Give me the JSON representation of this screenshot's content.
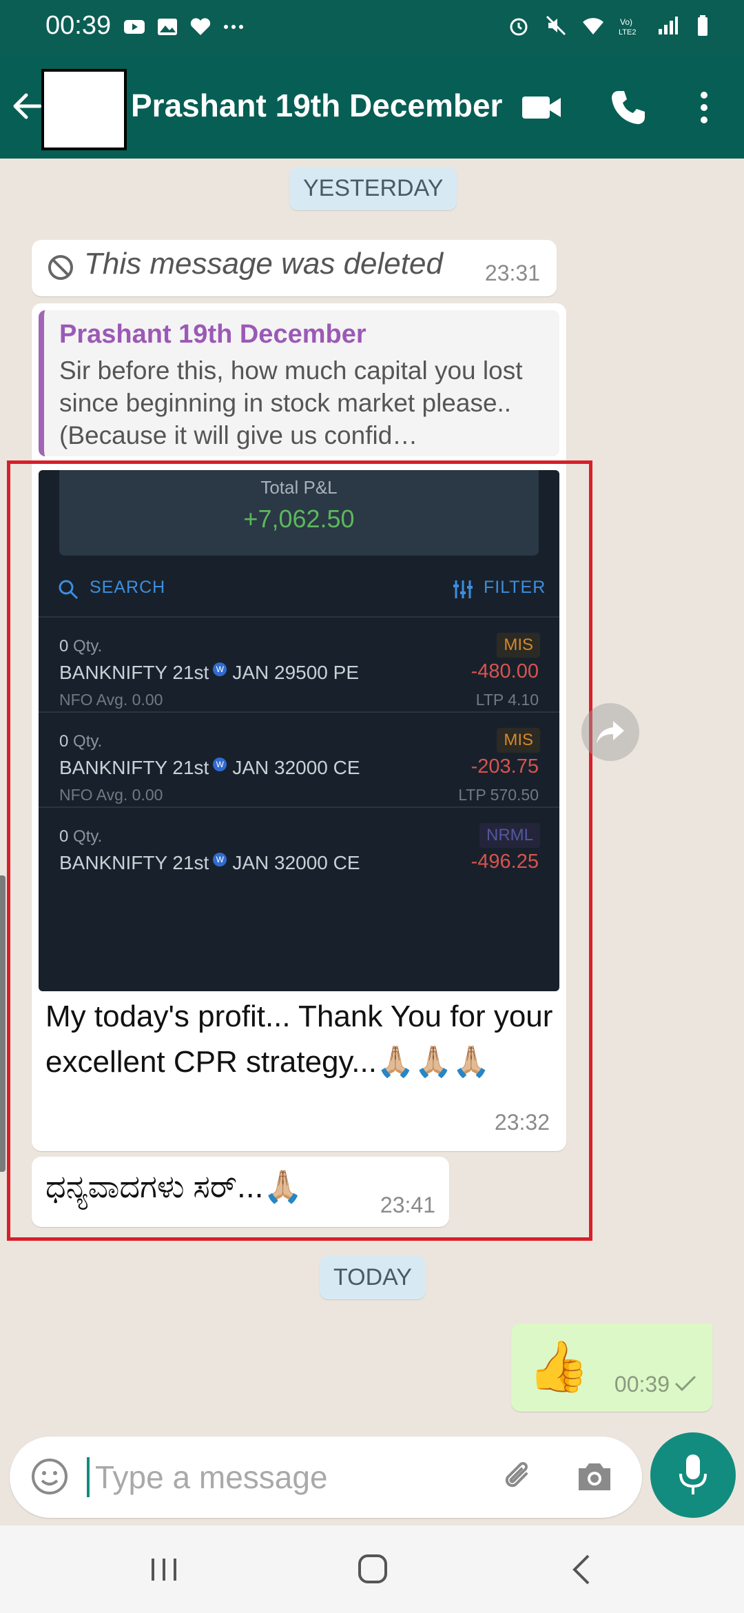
{
  "status_bar": {
    "time": "00:39"
  },
  "header": {
    "contact_name": "Prashant 19th December"
  },
  "chat": {
    "date_yesterday": "YESTERDAY",
    "date_today": "TODAY",
    "deleted_message": {
      "text": "This message was deleted",
      "time": "23:31"
    },
    "main_message": {
      "quote_author": "Prashant 19th December",
      "quote_text": "Sir before this, how much capital you lost since beginning in stock market please.. (Because it will give us confid…",
      "caption": "My today's profit... Thank You for your excellent CPR strategy...🙏🏼🙏🏼🙏🏼",
      "time": "23:32",
      "screenshot": {
        "total_pnl_label": "Total P&L",
        "total_pnl_value": "+7,062.50",
        "search_label": "SEARCH",
        "filter_label": "FILTER",
        "trades": [
          {
            "qty": "0",
            "qty_suffix": "Qty.",
            "name_prefix": "BANKNIFTY 21st",
            "name_suffix": "JAN 29500 PE",
            "meta": "NFO   Avg. 0.00",
            "badge": "MIS",
            "pnl": "-480.00",
            "ltp": "LTP 4.10"
          },
          {
            "qty": "0",
            "qty_suffix": "Qty.",
            "name_prefix": "BANKNIFTY 21st",
            "name_suffix": "JAN 32000 CE",
            "meta": "NFO   Avg. 0.00",
            "badge": "MIS",
            "pnl": "-203.75",
            "ltp": "LTP 570.50"
          },
          {
            "qty": "0",
            "qty_suffix": "Qty.",
            "name_prefix": "BANKNIFTY 21st",
            "name_suffix": "JAN 32000 CE",
            "badge": "NRML",
            "pnl": "-496.25"
          }
        ]
      }
    },
    "kannada_message": {
      "text": "ಧನ್ಯವಾದಗಳು ಸರ್...🙏🏼",
      "time": "23:41"
    },
    "outgoing_message": {
      "emoji": "👍",
      "time": "00:39"
    }
  },
  "input": {
    "placeholder": "Type a message"
  },
  "colors": {
    "header": "#075e54",
    "accent": "#128c7e",
    "outgoing_bubble": "#dcf8c6",
    "highlight": "#d71f2a",
    "profit": "#5cb85c",
    "loss": "#d9534f"
  }
}
